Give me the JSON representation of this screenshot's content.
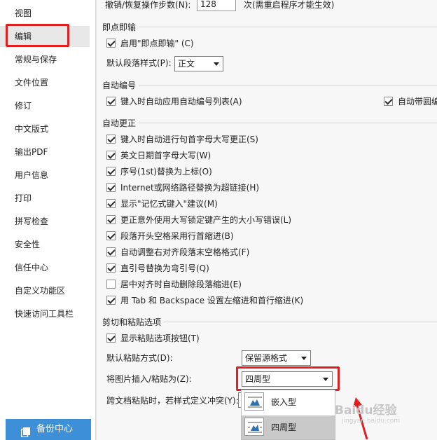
{
  "sidebar": {
    "items": [
      {
        "label": "视图"
      },
      {
        "label": "编辑"
      },
      {
        "label": "常规与保存"
      },
      {
        "label": "文件位置"
      },
      {
        "label": "修订"
      },
      {
        "label": "中文版式"
      },
      {
        "label": "输出PDF"
      },
      {
        "label": "用户信息"
      },
      {
        "label": "打印"
      },
      {
        "label": "拼写检查"
      },
      {
        "label": "安全性"
      },
      {
        "label": "信任中心"
      },
      {
        "label": "自定义功能区"
      },
      {
        "label": "快速访问工具栏"
      }
    ],
    "active_index": 1,
    "backup_label": "备份中心"
  },
  "undo": {
    "label": "撤销/恢复操作步数(N):",
    "value": "128",
    "suffix": "次(需重启程序才能生效)"
  },
  "instant": {
    "title": "即点即输",
    "enable_label": "启用\"即点即输\" (C)",
    "enable_checked": true,
    "style_label": "默认段落样式(P):",
    "style_value": "正文"
  },
  "autonum": {
    "title": "自动编号",
    "items": [
      {
        "label": "键入时自动应用自动编号列表(A)",
        "checked": true
      },
      {
        "label": "自动带圆编",
        "checked": true
      }
    ]
  },
  "autocorrect": {
    "title": "自动更正",
    "items": [
      {
        "label": "键入时自动进行句首字母大写更正(S)",
        "checked": true
      },
      {
        "label": "英文日期首字母大写(W)",
        "checked": true
      },
      {
        "label": "序号(1st)替换为上标(O)",
        "checked": true
      },
      {
        "label": "Internet或网络路径替换为超链接(H)",
        "checked": true
      },
      {
        "label": "显示\"记忆式键入\"建议(M)",
        "checked": true
      },
      {
        "label": "更正意外使用大写锁定键产生的大小写错误(L)",
        "checked": true
      },
      {
        "label": "段落开头空格采用行首缩进(B)",
        "checked": true
      },
      {
        "label": "自动调整右对齐段落末空格格式(F)",
        "checked": true
      },
      {
        "label": "直引号替换为弯引号(Q)",
        "checked": true
      },
      {
        "label": "居中对齐时自动删除段落缩进(E)",
        "checked": false
      },
      {
        "label": "用 Tab 和 Backspace 设置左缩进和首行缩进(K)",
        "checked": true
      }
    ]
  },
  "paste": {
    "title": "剪切和粘贴选项",
    "show_button_label": "显示粘贴选项按钮(T)",
    "show_button_checked": true,
    "default_label": "默认粘贴方式(D):",
    "default_value": "保留源格式",
    "image_label": "将图片插入/粘贴为(Z):",
    "image_value": "四周型",
    "cross_label": "跨文档粘贴时，若样式定义冲突(Y):",
    "dropdown_options": [
      {
        "label": "嵌入型",
        "selected": false
      },
      {
        "label": "四周型",
        "selected": true
      }
    ]
  },
  "watermark": {
    "text": "Baidu经验",
    "sub": "jingyan.baidu.com"
  },
  "colors": {
    "highlight": "#e02020",
    "backup_bg": "#3d8fd8"
  }
}
